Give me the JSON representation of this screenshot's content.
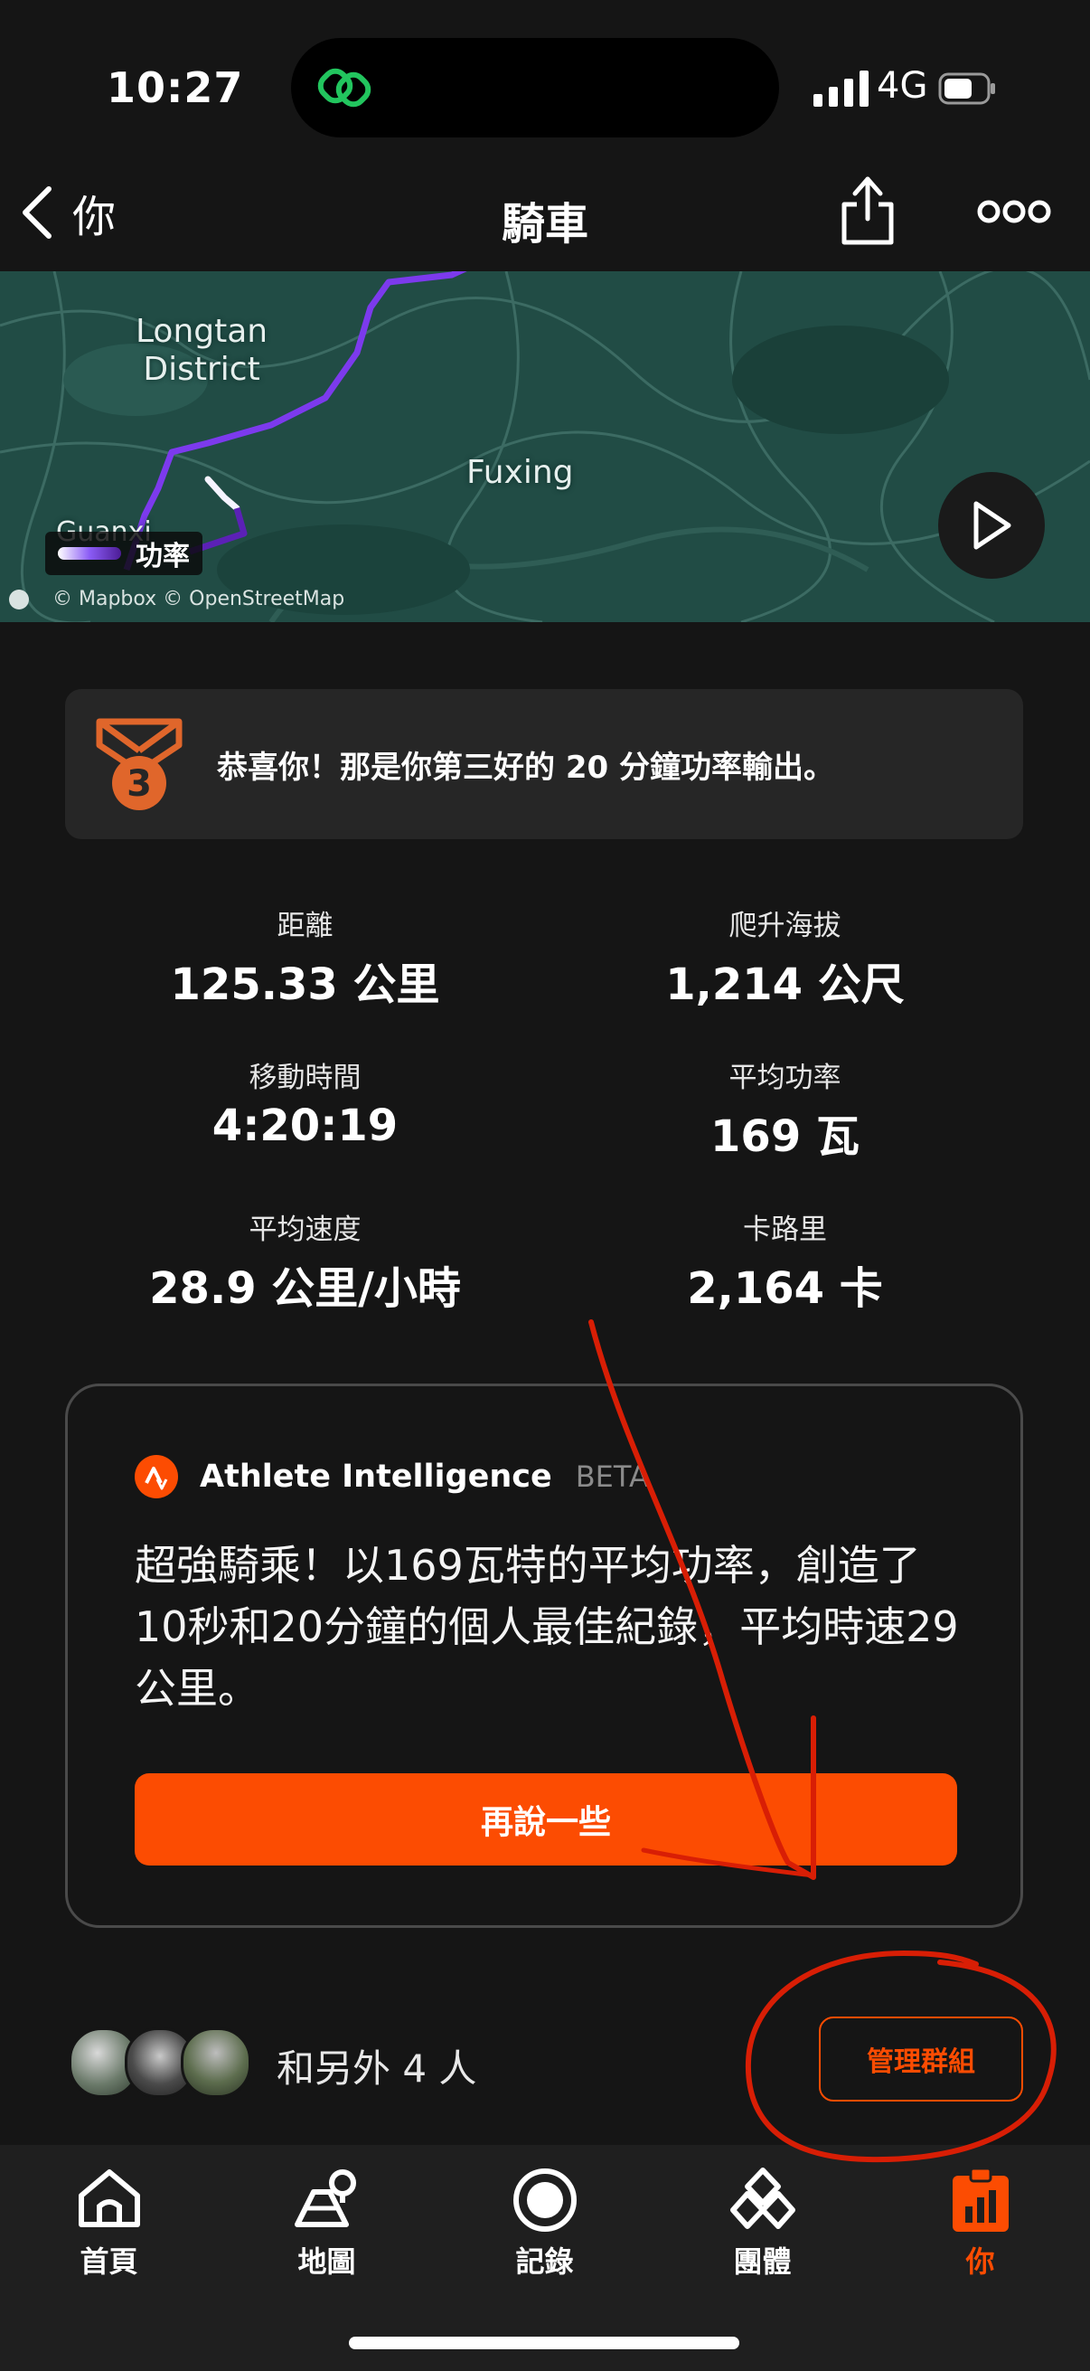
{
  "status_bar": {
    "time": "10:27",
    "network": "4G"
  },
  "nav": {
    "back_label": "你",
    "title": "騎車"
  },
  "map": {
    "labels": [
      "Longtan\nDistrict",
      "Fuxing",
      "Guanxi"
    ],
    "legend": "功率",
    "attribution": "© Mapbox © OpenStreetMap"
  },
  "achievement": {
    "medal_rank": "3",
    "text": "恭喜你！那是你第三好的 20 分鐘功率輸出。"
  },
  "stats": [
    {
      "label": "距離",
      "value": "125.33 公里"
    },
    {
      "label": "爬升海拔",
      "value": "1,214 公尺"
    },
    {
      "label": "移動時間",
      "value": "4:20:19"
    },
    {
      "label": "平均功率",
      "value": "169 瓦"
    },
    {
      "label": "平均速度",
      "value": "28.9 公里/小時"
    },
    {
      "label": "卡路里",
      "value": "2,164 卡"
    }
  ],
  "ai": {
    "title": "Athlete Intelligence",
    "badge": "BETA",
    "summary": "超強騎乘！以169瓦特的平均功率，創造了10秒和20分鐘的個人最佳紀錄，平均時速29公里。",
    "button": "再說一些"
  },
  "group": {
    "text": "和另外 4 人",
    "manage_button": "管理群組"
  },
  "tabs": [
    {
      "label": "首頁",
      "icon": "home-icon"
    },
    {
      "label": "地圖",
      "icon": "map-icon"
    },
    {
      "label": "記錄",
      "icon": "record-icon"
    },
    {
      "label": "團體",
      "icon": "groups-icon"
    },
    {
      "label": "你",
      "icon": "you-icon",
      "active": true
    }
  ],
  "colors": {
    "accent": "#fc4c02",
    "background": "#151515",
    "card": "#262626",
    "annotation": "#d81e05"
  }
}
